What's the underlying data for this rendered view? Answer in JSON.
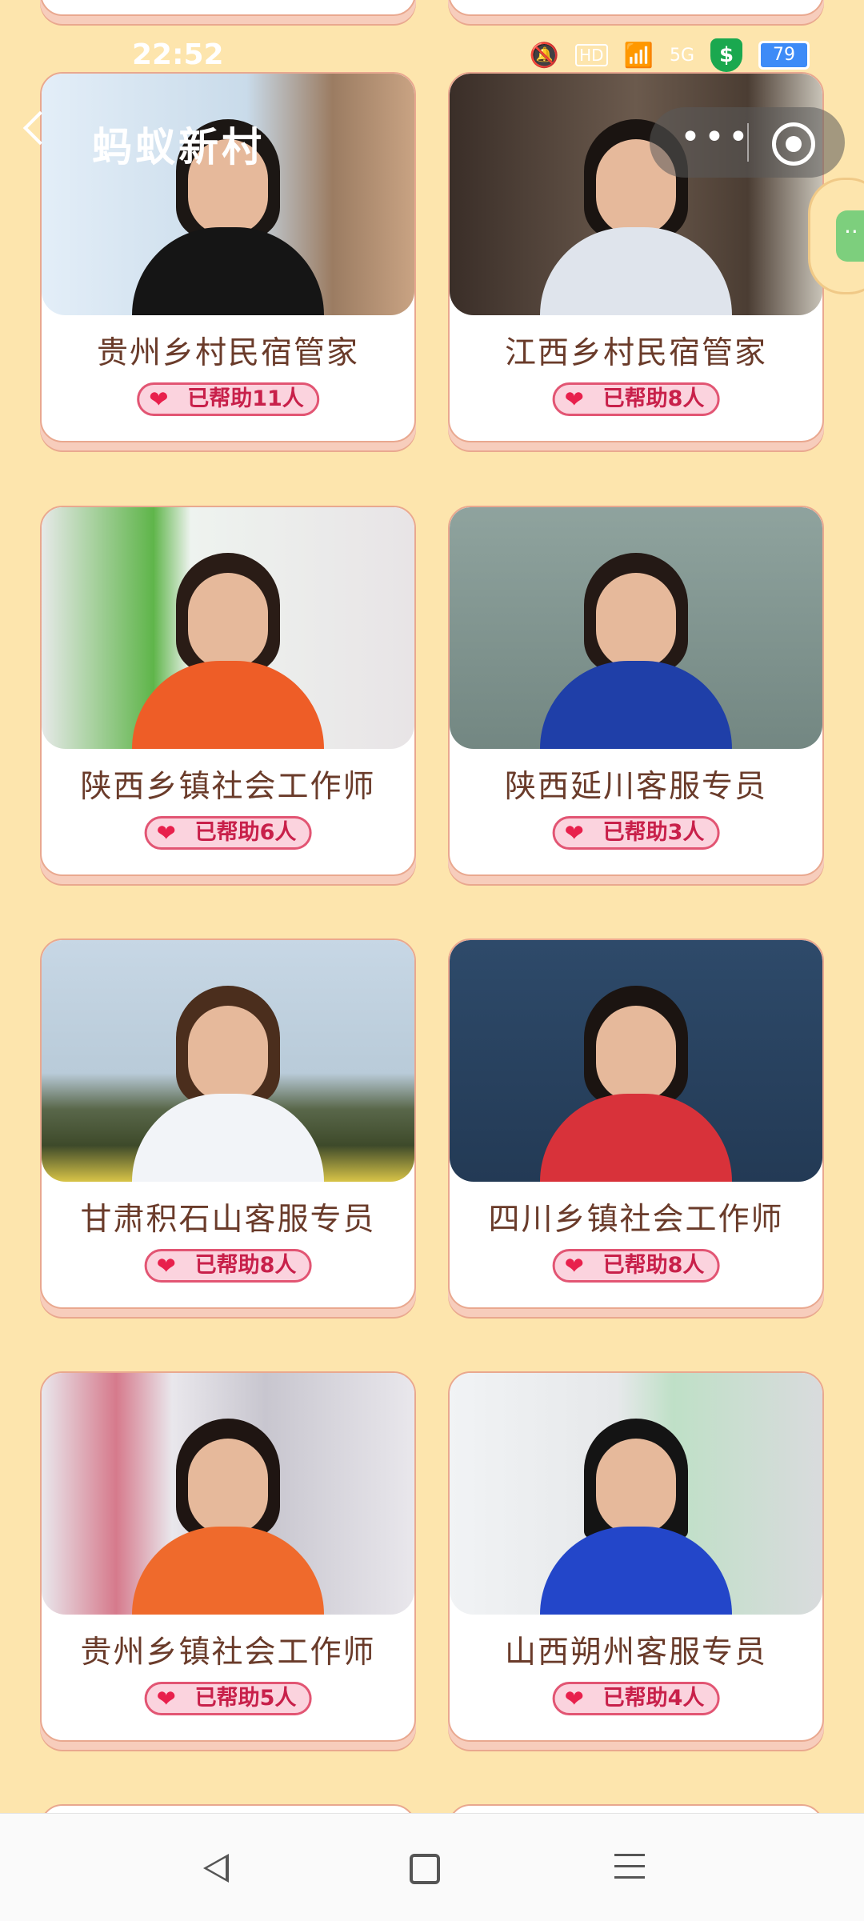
{
  "status_bar": {
    "time": "22:52",
    "hd": "HD",
    "network": "5G",
    "battery": "79"
  },
  "header": {
    "title": "蚂蚁新村",
    "more": "•••"
  },
  "cards": [
    {
      "title": "贵州乡村民宿管家",
      "badge": "已帮助11人"
    },
    {
      "title": "江西乡村民宿管家",
      "badge": "已帮助8人"
    },
    {
      "title": "陕西乡镇社会工作师",
      "badge": "已帮助6人"
    },
    {
      "title": "陕西延川客服专员",
      "badge": "已帮助3人"
    },
    {
      "title": "甘肃积石山客服专员",
      "badge": "已帮助8人"
    },
    {
      "title": "四川乡镇社会工作师",
      "badge": "已帮助8人"
    },
    {
      "title": "贵州乡镇社会工作师",
      "badge": "已帮助5人"
    },
    {
      "title": "山西朔州客服专员",
      "badge": "已帮助4人"
    }
  ],
  "icons": {
    "heart": "heart-icon",
    "back": "back-arrow-icon",
    "more": "more-dots-icon",
    "close": "mini-program-close-icon"
  }
}
